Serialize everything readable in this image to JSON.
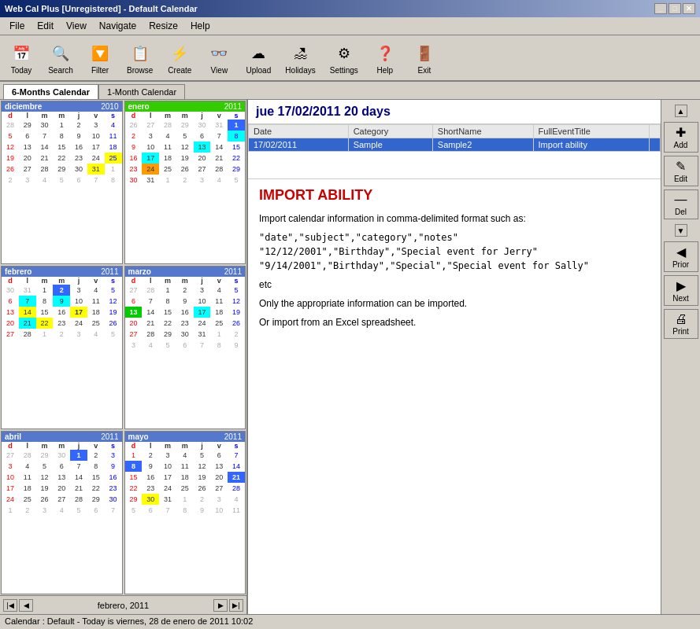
{
  "window": {
    "title": "Web Cal Plus [Unregistered] - Default Calendar",
    "controls": [
      "_",
      "□",
      "✕"
    ]
  },
  "menu": {
    "items": [
      "File",
      "Edit",
      "View",
      "Navigate",
      "Resize",
      "Help"
    ]
  },
  "toolbar": {
    "buttons": [
      {
        "label": "Today",
        "icon": "📅"
      },
      {
        "label": "Search",
        "icon": "🔍"
      },
      {
        "label": "Filter",
        "icon": "🔽"
      },
      {
        "label": "Browse",
        "icon": "📋"
      },
      {
        "label": "Create",
        "icon": "⚡"
      },
      {
        "label": "View",
        "icon": "👓"
      },
      {
        "label": "Upload",
        "icon": "☁"
      },
      {
        "label": "Holidays",
        "icon": "🏖"
      },
      {
        "label": "Settings",
        "icon": "⚙"
      },
      {
        "label": "Help",
        "icon": "❓"
      },
      {
        "label": "Exit",
        "icon": "🚪"
      }
    ]
  },
  "tabs": [
    {
      "label": "6-Months Calendar",
      "active": true
    },
    {
      "label": "1-Month Calendar",
      "active": false
    }
  ],
  "header": {
    "date_title": "jue 17/02/2011  20 days"
  },
  "event_table": {
    "columns": [
      "Date",
      "Category",
      "ShortName",
      "FullEventTitle"
    ],
    "rows": [
      {
        "date": "17/02/2011",
        "category": "Sample",
        "shortname": "Sample2",
        "title": "Import ability",
        "selected": true
      }
    ]
  },
  "event_detail": {
    "title": "IMPORT ABILITY",
    "paragraphs": [
      "Import calendar information in comma-delimited format such as:",
      "\"date\",\"subject\",\"category\",\"notes\"",
      "\"12/12/2001\",\"Birthday\",\"Special event for Jerry\"",
      "\"9/14/2001\",\"Birthday\",\"Special\",\"Special event for Sally\"",
      "etc",
      "Only the appropriate information can be imported.",
      "Or import from an Excel spreadsheet."
    ]
  },
  "right_sidebar": {
    "buttons": [
      {
        "label": "Add",
        "icon": "✚"
      },
      {
        "label": "Edit",
        "icon": "✎"
      },
      {
        "label": "Del",
        "icon": "—"
      },
      {
        "label": "Prior",
        "icon": "◀"
      },
      {
        "label": "Next",
        "icon": "▶"
      },
      {
        "label": "Print",
        "icon": "🖨"
      }
    ]
  },
  "calendars": [
    {
      "name": "diciembre",
      "year": "2010",
      "header_color": "#4488ff",
      "days_header": [
        "d",
        "l",
        "m",
        "m",
        "j",
        "v",
        "s"
      ],
      "weeks": [
        [
          "28",
          "29",
          "30",
          "1",
          "2",
          "3",
          "4"
        ],
        [
          "5",
          "6",
          "7",
          "8",
          "9",
          "10",
          "11"
        ],
        [
          "12",
          "13",
          "14",
          "15",
          "16",
          "17",
          "18"
        ],
        [
          "19",
          "20",
          "21",
          "22",
          "23",
          "24",
          "25"
        ],
        [
          "26",
          "27",
          "28",
          "29",
          "30",
          "31",
          "1"
        ],
        [
          "2",
          "3",
          "4",
          "5",
          "6",
          "7",
          "8"
        ]
      ],
      "highlights": {
        "31": "highlight-yellow",
        "25": "highlight-yellow"
      }
    },
    {
      "name": "enero",
      "year": "2011",
      "header_color": "#33cc00",
      "days_header": [
        "d",
        "l",
        "m",
        "m",
        "j",
        "v",
        "s"
      ],
      "weeks": [
        [
          "26",
          "27",
          "28",
          "29",
          "30",
          "31",
          "1"
        ],
        [
          "2",
          "3",
          "4",
          "5",
          "6",
          "7",
          "8"
        ],
        [
          "9",
          "10",
          "11",
          "12",
          "13",
          "14",
          "15"
        ],
        [
          "16",
          "17",
          "18",
          "19",
          "20",
          "21",
          "22"
        ],
        [
          "23",
          "24",
          "25",
          "26",
          "27",
          "28",
          "29"
        ],
        [
          "30",
          "31",
          "1",
          "2",
          "3",
          "4",
          "5"
        ]
      ],
      "highlights": {
        "1r1": "highlight-blue",
        "8r1": "highlight-cyan",
        "17r2": "highlight-cyan",
        "24r4": "highlight-orange"
      }
    },
    {
      "name": "febrero",
      "year": "2011",
      "header_color": "#4488ff",
      "days_header": [
        "d",
        "l",
        "m",
        "m",
        "j",
        "v",
        "s"
      ],
      "weeks": [
        [
          "30",
          "31",
          "1",
          "2",
          "3",
          "4",
          "5"
        ],
        [
          "6",
          "7",
          "8",
          "9",
          "10",
          "11",
          "12"
        ],
        [
          "13",
          "14",
          "15",
          "16",
          "17",
          "18",
          "19"
        ],
        [
          "20",
          "21",
          "22",
          "23",
          "24",
          "25",
          "26"
        ],
        [
          "27",
          "28",
          "1",
          "2",
          "3",
          "4",
          "5"
        ]
      ],
      "highlights": {
        "2r0c1": "highlight-blue",
        "7r1c1": "highlight-cyan",
        "9r1c3": "highlight-cyan",
        "14r2c1": "highlight-yellow",
        "21r3c1": "highlight-cyan",
        "22r3c2": "highlight-yellow"
      }
    },
    {
      "name": "marzo",
      "year": "2011",
      "header_color": "#4488ff",
      "days_header": [
        "d",
        "l",
        "m",
        "m",
        "j",
        "v",
        "s"
      ],
      "weeks": [
        [
          "27",
          "28",
          "1",
          "2",
          "3",
          "4",
          "5"
        ],
        [
          "6",
          "7",
          "8",
          "9",
          "10",
          "11",
          "12"
        ],
        [
          "13",
          "14",
          "15",
          "16",
          "17",
          "18",
          "19"
        ],
        [
          "20",
          "21",
          "22",
          "23",
          "24",
          "25",
          "26"
        ],
        [
          "27",
          "28",
          "29",
          "30",
          "31",
          "1",
          "2"
        ],
        [
          "3",
          "4",
          "5",
          "6",
          "7",
          "8",
          "9"
        ]
      ],
      "highlights": {
        "13r2": "highlight-green",
        "17r2c4": "highlight-cyan"
      }
    },
    {
      "name": "abril",
      "year": "2011",
      "header_color": "#4488ff",
      "days_header": [
        "d",
        "l",
        "m",
        "m",
        "j",
        "v",
        "s"
      ],
      "weeks": [
        [
          "27",
          "28",
          "29",
          "30",
          "1",
          "2",
          "3"
        ],
        [
          "3",
          "4",
          "5",
          "6",
          "7",
          "8",
          "9"
        ],
        [
          "10",
          "11",
          "12",
          "13",
          "14",
          "15",
          "16"
        ],
        [
          "17",
          "18",
          "19",
          "20",
          "21",
          "22",
          "23"
        ],
        [
          "24",
          "25",
          "26",
          "27",
          "28",
          "29",
          "30"
        ],
        [
          "1",
          "2",
          "3",
          "4",
          "5",
          "6",
          "7"
        ]
      ],
      "highlights": {
        "1r0c4": "highlight-blue"
      }
    },
    {
      "name": "mayo",
      "year": "2011",
      "header_color": "#4488ff",
      "days_header": [
        "d",
        "l",
        "m",
        "m",
        "j",
        "v",
        "s"
      ],
      "weeks": [
        [
          "1",
          "2",
          "3",
          "4",
          "5",
          "6",
          "7"
        ],
        [
          "8",
          "9",
          "10",
          "11",
          "12",
          "13",
          "14"
        ],
        [
          "15",
          "16",
          "17",
          "18",
          "19",
          "20",
          "21"
        ],
        [
          "22",
          "23",
          "24",
          "25",
          "26",
          "27",
          "28"
        ],
        [
          "29",
          "30",
          "31",
          "1",
          "2",
          "3",
          "4"
        ],
        [
          "5",
          "6",
          "7",
          "8",
          "9",
          "10",
          "11"
        ]
      ],
      "highlights": {
        "8r1c0": "highlight-blue",
        "21r2c6": "highlight-blue",
        "30r4c1": "highlight-yellow"
      }
    }
  ],
  "nav": {
    "label": "febrero, 2011"
  },
  "status": {
    "text": "Calendar : Default   - Today is viernes, 28 de enero de 2011 10:02"
  }
}
